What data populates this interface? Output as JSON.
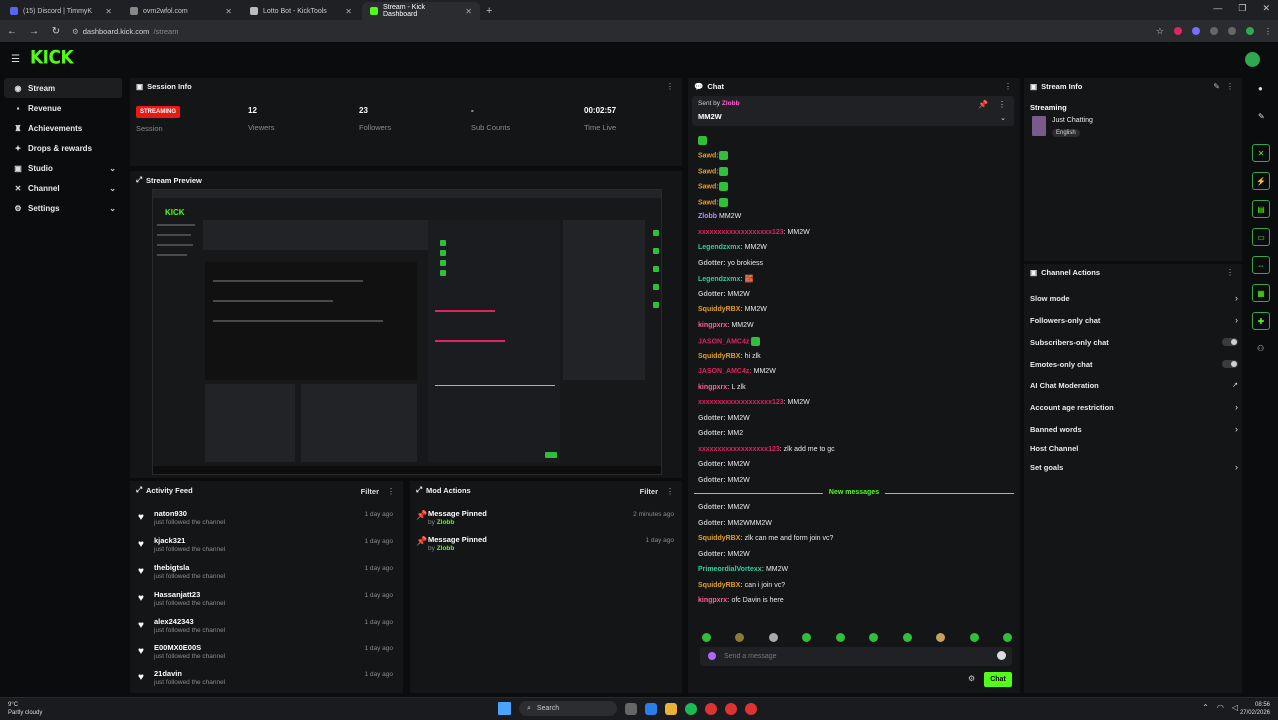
{
  "browser": {
    "tabs": [
      {
        "label": "(15) Discord | TimmyK",
        "active": false
      },
      {
        "label": "ovm2wfol.com",
        "active": false
      },
      {
        "label": "Lotto Bot - KickTools",
        "active": false
      },
      {
        "label": "Stream - Kick Dashboard",
        "active": true
      }
    ],
    "url_host": "dashboard.kick.com",
    "url_path": "/stream"
  },
  "header": {
    "logo": "KICK"
  },
  "sidebar": {
    "items": [
      {
        "label": "Stream",
        "icon": "stream-icon",
        "active": true,
        "expand": false
      },
      {
        "label": "Revenue",
        "icon": "revenue-icon",
        "active": false,
        "expand": false
      },
      {
        "label": "Achievements",
        "icon": "trophy-icon",
        "active": false,
        "expand": false
      },
      {
        "label": "Drops & rewards",
        "icon": "gift-icon",
        "active": false,
        "expand": false
      },
      {
        "label": "Studio",
        "icon": "studio-icon",
        "active": false,
        "expand": true
      },
      {
        "label": "Channel",
        "icon": "channel-icon",
        "active": false,
        "expand": true
      },
      {
        "label": "Settings",
        "icon": "gear-icon",
        "active": false,
        "expand": true
      }
    ]
  },
  "session": {
    "title": "Session Info",
    "status": "STREAMING",
    "status_label": "Session",
    "viewers": "12",
    "viewers_label": "Viewers",
    "followers": "23",
    "followers_label": "Followers",
    "subs": "-",
    "subs_label": "Sub Counts",
    "time": "00:02:57",
    "time_label": "Time Live"
  },
  "preview": {
    "title": "Stream Preview"
  },
  "activity": {
    "title": "Activity Feed",
    "filter": "Filter",
    "items": [
      {
        "name": "naton930",
        "sub": "just followed the channel",
        "time": "1 day ago"
      },
      {
        "name": "kjack321",
        "sub": "just followed the channel",
        "time": "1 day ago"
      },
      {
        "name": "thebigtsla",
        "sub": "just followed the channel",
        "time": "1 day ago"
      },
      {
        "name": "Hassanjatt23",
        "sub": "just followed the channel",
        "time": "1 day ago"
      },
      {
        "name": "alex242343",
        "sub": "just followed the channel",
        "time": "1 day ago"
      },
      {
        "name": "E00MX0E00S",
        "sub": "just followed the channel",
        "time": "1 day ago"
      },
      {
        "name": "21davin",
        "sub": "just followed the channel",
        "time": "1 day ago"
      }
    ]
  },
  "mod": {
    "title": "Mod Actions",
    "filter": "Filter",
    "items": [
      {
        "name": "Message Pinned",
        "by": "by",
        "who": "Zlobb",
        "time": "2 minutes ago"
      },
      {
        "name": "Message Pinned",
        "by": "by",
        "who": "Zlobb",
        "time": "1 day ago"
      }
    ]
  },
  "chat": {
    "title": "Chat",
    "pinned_by": "Sent by",
    "pinned_user": "Zlobb",
    "pinned_msg": "MM2W",
    "new_messages": "New messages",
    "placeholder": "Send a message",
    "send": "Chat",
    "messages": [
      {
        "user": "",
        "color": "#e0a126",
        "text": "",
        "emote": true
      },
      {
        "user": "Sawd:",
        "color": "#e0a126",
        "text": "",
        "emote": true
      },
      {
        "user": "Sawd:",
        "color": "#e0a126",
        "text": "",
        "emote": true
      },
      {
        "user": "Sawd:",
        "color": "#e0a126",
        "text": "",
        "emote": true
      },
      {
        "user": "Sawd:",
        "color": "#e0a126",
        "text": "",
        "emote": true
      },
      {
        "user": "Zlobb",
        "color": "#b58cff",
        "text": " MM2W",
        "emote": false
      },
      {
        "user": "xxxxxxxxxxxxxxxxxxx123",
        "color": "#e0245e",
        "text": ": MM2W",
        "emote": false
      },
      {
        "user": "Legendzxmx:",
        "color": "#2fd0a0",
        "text": " MM2W",
        "emote": false
      },
      {
        "user": "Gdotter:",
        "color": "#bdbdbd",
        "text": " yo brokiess",
        "emote": false
      },
      {
        "user": "Legendzxmx:",
        "color": "#2fd0a0",
        "text": " 🧱",
        "emote": false
      },
      {
        "user": "Gdotter:",
        "color": "#bdbdbd",
        "text": " MM2W",
        "emote": false
      },
      {
        "user": "SquiddyRBX:",
        "color": "#e0a126",
        "text": " MM2W",
        "emote": false
      },
      {
        "user": "kingpxrx:",
        "color": "#ff5f9a",
        "text": " MM2W",
        "emote": false
      },
      {
        "user": "JASON_AMC4z",
        "color": "#e0245e",
        "text": " ",
        "emote": true
      },
      {
        "user": "SquiddyRBX:",
        "color": "#e0a126",
        "text": " hi zlk",
        "emote": false
      },
      {
        "user": "JASON_AMC4z:",
        "color": "#e0245e",
        "text": " MM2W",
        "emote": false
      },
      {
        "user": "kingpxrx:",
        "color": "#ff5f9a",
        "text": " L zlk",
        "emote": false
      },
      {
        "user": "xxxxxxxxxxxxxxxxxxx123",
        "color": "#e0245e",
        "text": ": MM2W",
        "emote": false
      },
      {
        "user": "Gdotter:",
        "color": "#bdbdbd",
        "text": " MM2W",
        "emote": false
      },
      {
        "user": "Gdotter:",
        "color": "#bdbdbd",
        "text": " MM2",
        "emote": false
      },
      {
        "user": "xxxxxxxxxxxxxxxxxx123",
        "color": "#e0245e",
        "text": ": zlk add me to gc",
        "emote": false
      },
      {
        "user": "Gdotter:",
        "color": "#bdbdbd",
        "text": " MM2W",
        "emote": false
      },
      {
        "user": "Gdotter:",
        "color": "#bdbdbd",
        "text": " MM2W",
        "emote": false
      }
    ],
    "after": [
      {
        "user": "Gdotter:",
        "color": "#bdbdbd",
        "text": " MM2W"
      },
      {
        "user": "Gdotter:",
        "color": "#bdbdbd",
        "text": " MM2WMM2W"
      },
      {
        "user": "SquiddyRBX:",
        "color": "#e0a126",
        "text": " zlk can me and form join vc?"
      },
      {
        "user": "Gdotter:",
        "color": "#bdbdbd",
        "text": " MM2W"
      },
      {
        "user": "PrimeordialVortexx:",
        "color": "#2fd0a0",
        "text": " MM2W"
      },
      {
        "user": "SquiddyRBX:",
        "color": "#e0a126",
        "text": " can i join vc?"
      },
      {
        "user": "kingpxrx:",
        "color": "#ff5f9a",
        "text": " ofc Davin is here"
      }
    ]
  },
  "stream_info": {
    "title": "Stream Info",
    "label": "Streaming",
    "category": "Just Chatting",
    "language": "English"
  },
  "channel_actions": {
    "title": "Channel Actions",
    "items": [
      {
        "label": "Slow mode",
        "control": "arrow"
      },
      {
        "label": "Followers-only chat",
        "control": "arrow"
      },
      {
        "label": "Subscribers-only chat",
        "control": "toggle"
      },
      {
        "label": "Emotes-only chat",
        "control": "toggle"
      },
      {
        "label": "AI Chat Moderation",
        "control": "external"
      },
      {
        "label": "Account age restriction",
        "control": "arrow"
      },
      {
        "label": "Banned words",
        "control": "arrow"
      },
      {
        "label": "Host Channel",
        "control": "none"
      },
      {
        "label": "Set goals",
        "control": "arrow"
      }
    ]
  },
  "taskbar": {
    "weather_temp": "9°C",
    "weather_desc": "Partly cloudy",
    "search": "Search",
    "time": "08:56",
    "date": "27/02/2026"
  },
  "colors": {
    "accent": "#53fc18",
    "live": "#e91916",
    "panel": "#141517"
  }
}
